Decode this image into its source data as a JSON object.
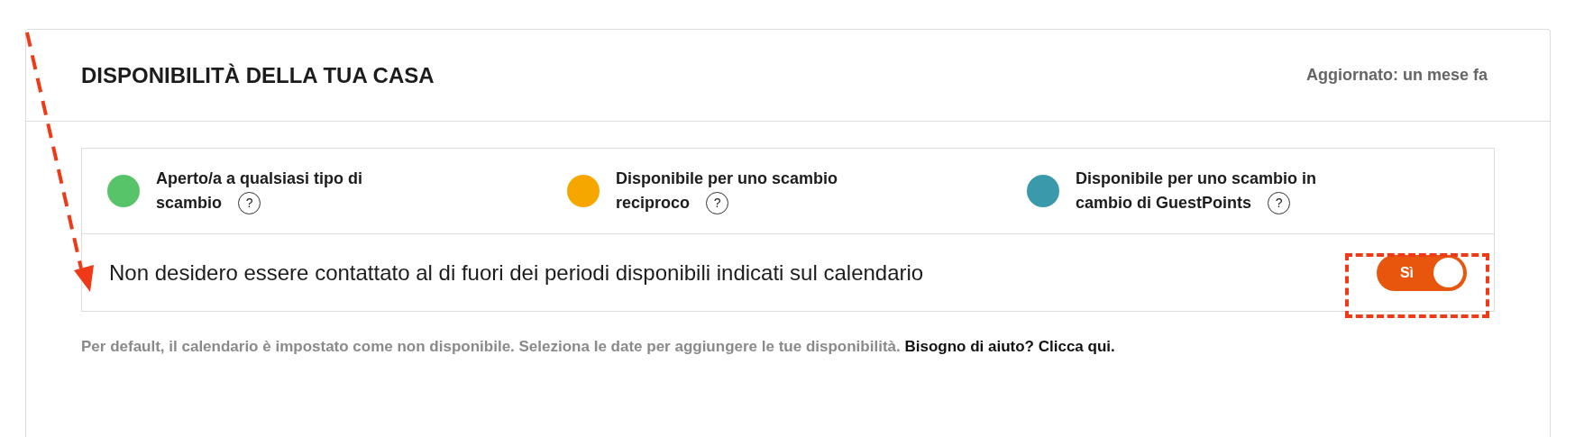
{
  "section": {
    "title": "DISPONIBILITÀ DELLA TUA CASA",
    "updated": "Aggiornato: un mese fa"
  },
  "legend": [
    {
      "label_lines": [
        "Aperto/a a qualsiasi tipo di",
        "scambio"
      ],
      "color": "#57c46a"
    },
    {
      "label_lines": [
        "Disponibile per uno scambio",
        "reciproco"
      ],
      "color": "#f5a700"
    },
    {
      "label_lines": [
        "Disponibile per uno scambio in",
        "cambio di GuestPoints"
      ],
      "color": "#3a9aab"
    }
  ],
  "help_mark": "?",
  "setting": {
    "label": "Non desidero essere contattato al di fuori dei periodi disponibili indicati sul calendario",
    "toggle_label": "Sì",
    "on": true
  },
  "note": {
    "text": "Per default, il calendario è impostato come non disponibile. Seleziona le date per aggiungere le tue disponibilità.",
    "link": "Bisogno di aiuto? Clicca qui."
  }
}
